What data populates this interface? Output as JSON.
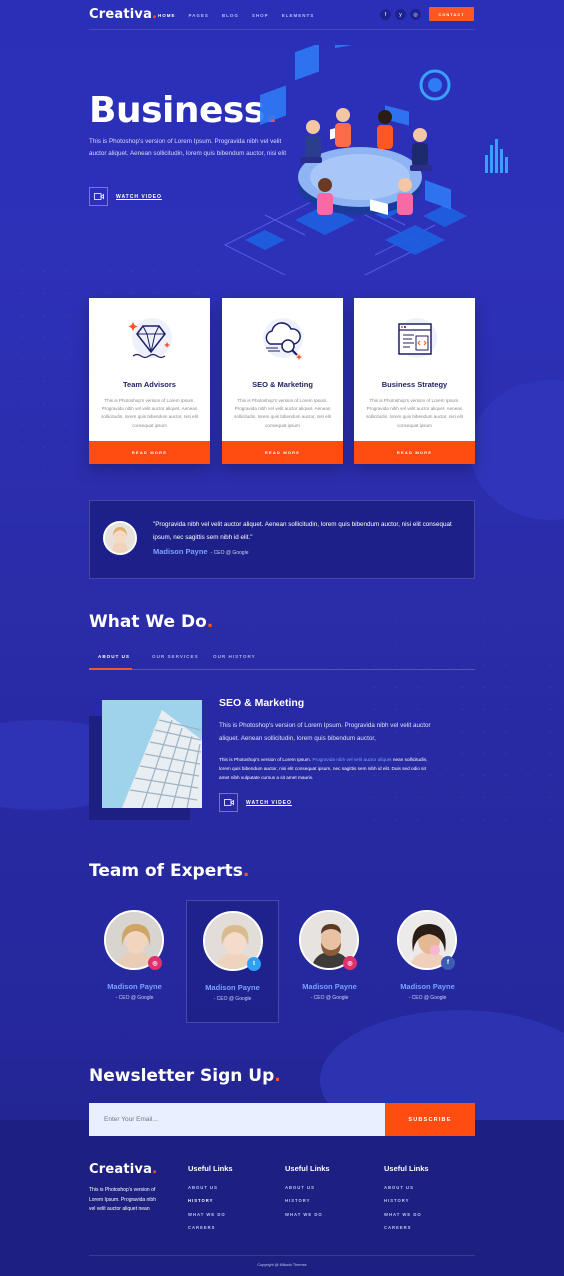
{
  "header": {
    "logo": "Creativa",
    "nav": [
      "HOME",
      "PAGES",
      "BLOG",
      "SHOP",
      "ELEMENTS"
    ],
    "social": [
      "f",
      "y",
      "◎"
    ],
    "contact_label": "CONTACT"
  },
  "hero": {
    "title": "Business",
    "text": "This is Photoshop's version  of Lorem Ipsum. Progravida nibh vel velit auctor aliquet. Aenean sollicitudin, lorem quis bibendum auctor, nisi elit",
    "watch_label": "WATCH VIDEO"
  },
  "services": [
    {
      "title": "Team Advisors",
      "text": "This is Photoshop's version  of Lorem Ipsum. Progravida nibh vel velit auctor aliquet. Aenean sollicitudin, lorem quis bibendum auctor, nisi elit consequat ipsum",
      "button": "READ MORE",
      "icon": "diamond-icon"
    },
    {
      "title": "SEO & Marketing",
      "text": "This is Photoshop's version  of Lorem Ipsum. Progravida nibh vel velit auctor aliquet. Aenean sollicitudin, lorem quis bibendum auctor, nisi elit consequat ipsum",
      "button": "READ MORE",
      "icon": "cloud-search-icon"
    },
    {
      "title": "Business Strategy",
      "text": "This is Photoshop's version  of Lorem Ipsum. Progravida nibh vel velit auctor aliquet. Aenean sollicitudin, lorem quis bibendum auctor, nisi elit consequat ipsum",
      "button": "READ MORE",
      "icon": "code-browser-icon"
    }
  ],
  "testimonial": {
    "quote": "\"Progravida nibh vel velit auctor aliquet. Aenean sollicitudin, lorem quis bibendum auctor, nisi elit consequat ipsum, nec sagittis sem nibh id elit.\"",
    "name": "Madison Payne",
    "role": "- CEO @ Google"
  },
  "what_we_do": {
    "title": "What We Do",
    "tabs": [
      "ABOUT US",
      "OUR SERVICES",
      "OUR HISTORY"
    ],
    "heading": "SEO & Marketing",
    "text1": "This is Photoshop's version  of Lorem Ipsum. Progravida nibh vel velit auctor aliquet. Aenean sollicitudin, lorem quis bibendum auctor,",
    "text2_a": "This is Photoshop's version  of Lorem Ipsum. ",
    "text2_hl": "Progravida nibh vel velit auctor aliquet",
    "text2_b": " nean sollicitudin, lorem quis bibendum auctor, nisi elit consequat ipsum, nec sagittis sem nibh id elit. Duis sed odio sit amet nibh vulputate cursus a sit amet mauris.",
    "watch_label": "WATCH VIDEO"
  },
  "team": {
    "title": "Team of Experts",
    "members": [
      {
        "name": "Madison Payne",
        "role": "- CEO @ Google",
        "badge": "◎",
        "badge_color": "#e0306e"
      },
      {
        "name": "Madison Payne",
        "role": "- CEO @ Google",
        "badge": "t",
        "badge_color": "#2ea1f2"
      },
      {
        "name": "Madison Payne",
        "role": "- CEO @ Google",
        "badge": "◎",
        "badge_color": "#e0306e"
      },
      {
        "name": "Madison Payne",
        "role": "- CEO @ Google",
        "badge": "f",
        "badge_color": "#3b5bb5"
      }
    ]
  },
  "newsletter": {
    "title": "Newsletter Sign Up",
    "placeholder": "Enter Your Email...",
    "button": "SUBSCRIBE"
  },
  "footer": {
    "logo": "Creativa",
    "about": "This is Photoshop's version  of Lorem Ipsum. Progravida nibh vel velit auctor aliquet nean",
    "columns": [
      {
        "title": "Useful Links",
        "links": [
          "ABOUT US",
          "HISTORY",
          "WHAT WE DO",
          "CAREERS"
        ]
      },
      {
        "title": "Useful Links",
        "links": [
          "ABOUT US",
          "HISTORY",
          "WHAT WE DO"
        ]
      },
      {
        "title": "Useful Links",
        "links": [
          "ABOUT US",
          "HISTORY",
          "WHAT WE DO",
          "CAREERS"
        ]
      }
    ],
    "copyright": "Copyright @ Mikado Themes"
  },
  "colors": {
    "accent": "#ff5722",
    "brand_bg": "#2a2fb8",
    "link_blue": "#7aa2ff"
  }
}
